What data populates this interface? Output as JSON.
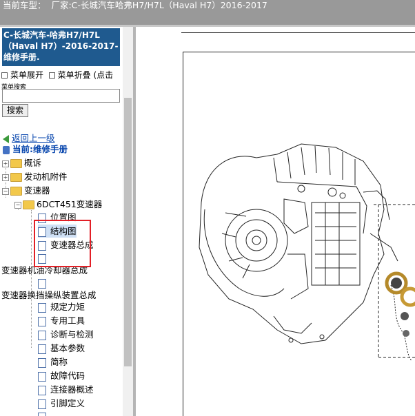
{
  "header": {
    "label": "当前车型：",
    "vehicle": "厂家:C-长城汽车哈弗H7/H7L（Haval H7）2016-2017"
  },
  "sidebar": {
    "title": "C-长城汽车-哈弗H7/H7L（Haval H7）-2016-2017- 维修手册.",
    "menu_expand": "菜单展开",
    "menu_collapse": "菜单折叠 (点击",
    "search_label": "菜单搜索",
    "search_placeholder": "",
    "search_button": "搜索",
    "back_label": "返回上一级",
    "current_label": "当前:维修手册",
    "tree": {
      "overview": "概诉",
      "engine_accessories": "发动机附件",
      "transmission": "变速器",
      "dct": "6DCT451变速器",
      "position_diagram": "位置图",
      "structure_diagram": "结构图",
      "transmission_assembly": "变速器总成",
      "oil_cooler": "变速器机油冷却器总成",
      "shift_control": "变速器换挡操纵装置总成",
      "torque_spec": "规定力矩",
      "special_tools": "专用工具",
      "diagnosis": "诊断与检测",
      "basic_params": "基本参数",
      "abbreviations": "简称",
      "fault_codes": "故障代码",
      "connector_overview": "连接器概述",
      "pin_definition": "引脚定义"
    }
  },
  "colors": {
    "header_bg": "#999999",
    "title_bg": "#1f5a8f",
    "link": "#0645ad",
    "highlight_box": "#e21f26"
  }
}
